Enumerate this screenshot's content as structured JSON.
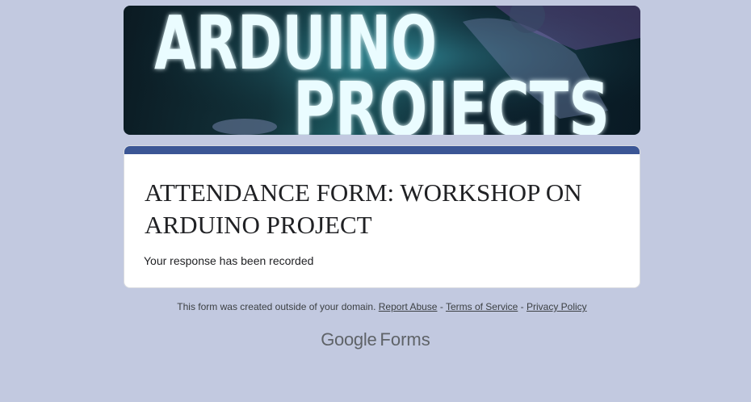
{
  "banner": {
    "line1": "ARDUINO",
    "line2": "PROJECTS"
  },
  "form": {
    "title": "ATTENDANCE FORM: WORKSHOP ON ARDUINO PROJECT",
    "response": "Your response has been recorded"
  },
  "footer": {
    "notice": "This form was created outside of your domain.",
    "separator": "-",
    "report_abuse": "Report Abuse",
    "terms": "Terms of Service",
    "privacy": "Privacy Policy"
  },
  "logo": {
    "brand": "Google",
    "product": "Forms"
  },
  "colors": {
    "page_bg": "#c2c9e0",
    "accent": "#3b5695",
    "card_bg": "#ffffff"
  }
}
